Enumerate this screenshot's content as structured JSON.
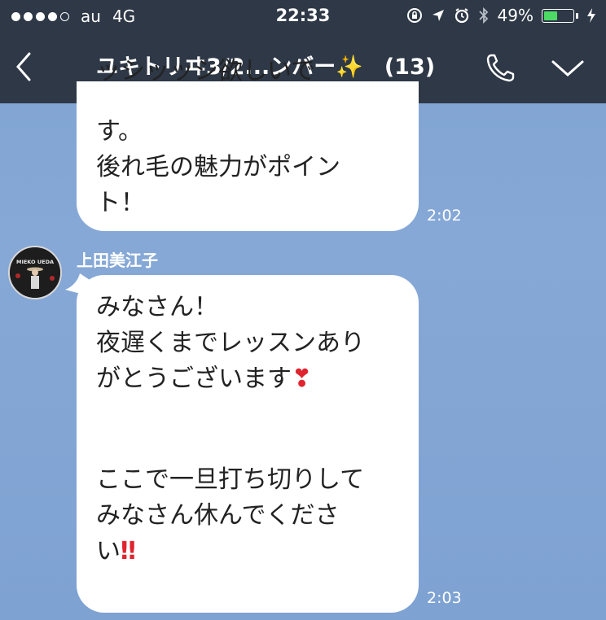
{
  "status_bar": {
    "carrier": "au",
    "network": "4G",
    "time": "22:33",
    "battery": "49%",
    "battery_level": 0.49,
    "signal_bars": 4
  },
  "nav": {
    "title": "ユキトリヰ3/2...ンバー✨",
    "count": "(13)",
    "page_count": 3,
    "active_page": 0
  },
  "messages": [
    {
      "text": "す。\n後れ毛の魅力がポイント！",
      "text_lines": [
        "す。",
        "後れ毛の魅力がポイン",
        "ト！"
      ],
      "time": "2:02"
    },
    {
      "sender": "上田美江子",
      "avatar_label": "MIEKO UEDA",
      "lines": [
        "みなさん！",
        "夜遅くまでレッスンあり",
        "がとうございます",
        "",
        "ここで一旦打ち切りして",
        "みなさん休んでくださ",
        "い"
      ],
      "heart_emoji": "❣",
      "bang_emoji": "‼",
      "time": "2:03"
    }
  ],
  "colors": {
    "bar_bg": "#2e3846",
    "chat_bg": "#86a8d6",
    "battery_fill": "#4cd964",
    "emoji_red": "#e0242f"
  }
}
